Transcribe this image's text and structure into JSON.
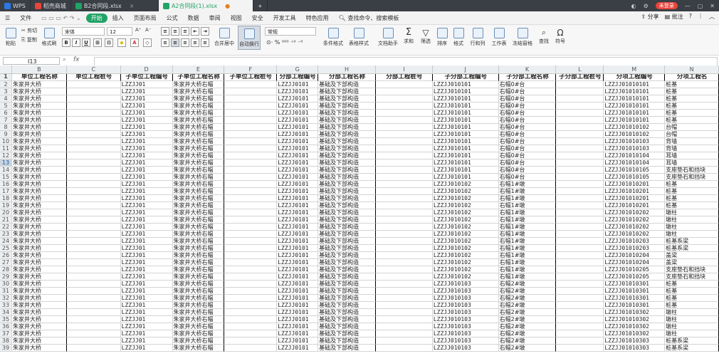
{
  "titlebar": {
    "tabs": [
      {
        "label": "WPS",
        "color": "#2b78e4"
      },
      {
        "label": "稻壳商城",
        "color": "#e8453c"
      },
      {
        "label": "B2合同段.xlsx",
        "color": "#21a366"
      },
      {
        "label": "A2合同段(1).xlsx",
        "color": "#21a366"
      }
    ],
    "badge": "未登录"
  },
  "menubar": {
    "file": "文件",
    "items": [
      "开始",
      "插入",
      "页面布局",
      "公式",
      "数据",
      "审阅",
      "视图",
      "安全",
      "开发工具",
      "特色应用"
    ],
    "search": "查找命令、搜索模板",
    "share": "分享",
    "comment": "批注"
  },
  "ribbon": {
    "paste": "粘贴",
    "cut": "剪切",
    "copy": "复制",
    "format_painter": "格式刷",
    "font_name": "宋体",
    "font_size": "12",
    "merge_center": "合并居中",
    "wrap_text": "自动换行",
    "number_format": "常规",
    "conditional_format": "条件格式",
    "table_style": "表格样式",
    "doc_helper": "文档助手",
    "sum": "求和",
    "filter": "筛选",
    "sort": "排序",
    "format": "格式",
    "rows_cols": "行和列",
    "worksheet": "工作表",
    "freeze": "冻结窗格",
    "find": "查找",
    "symbol": "符号"
  },
  "formula_bar": {
    "name_box": "I13",
    "fx": "fx"
  },
  "columns": [
    {
      "key": "B",
      "w": 77
    },
    {
      "key": "C",
      "w": 76
    },
    {
      "key": "D",
      "w": 73
    },
    {
      "key": "E",
      "w": 73
    },
    {
      "key": "F",
      "w": 74
    },
    {
      "key": "G",
      "w": 58
    },
    {
      "key": "H",
      "w": 81
    },
    {
      "key": "I",
      "w": 80
    },
    {
      "key": "J",
      "w": 93
    },
    {
      "key": "K",
      "w": 81
    },
    {
      "key": "L",
      "w": 67
    },
    {
      "key": "M",
      "w": 86
    },
    {
      "key": "N",
      "w": 76
    }
  ],
  "header": [
    "单位工程名称",
    "单位工程桩号",
    "子单位工程编号",
    "子单位工程名称",
    "子单位工程桩号",
    "分部工程编号",
    "分部工程名称",
    "分部工程桩号",
    "子分部工程编号",
    "子分部工程名称",
    "子分部工程桩号",
    "分项工程编号",
    "分项工程名"
  ],
  "selected_row": 13,
  "rows": [
    {
      "n": 2,
      "D": "LZZJJ01",
      "G": "LZZJJ0101",
      "J": "LZZJJ010101",
      "K": "右幅0#台",
      "M": "LZZJJ01010101",
      "N": "桩基"
    },
    {
      "n": 3,
      "D": "LZZJJ01",
      "G": "LZZJJ0101",
      "J": "LZZJJ010101",
      "K": "右幅0#台",
      "M": "LZZJJ01010101",
      "N": "桩基"
    },
    {
      "n": 4,
      "D": "LZZJJ01",
      "G": "LZZJJ0101",
      "J": "LZZJJ010101",
      "K": "右幅0#台",
      "M": "LZZJJ01010101",
      "N": "桩基"
    },
    {
      "n": 5,
      "D": "LZZJJ01",
      "G": "LZZJJ0101",
      "J": "LZZJJ010101",
      "K": "右幅0#台",
      "M": "LZZJJ01010101",
      "N": "桩基"
    },
    {
      "n": 6,
      "D": "LZZJJ01",
      "G": "LZZJJ0101",
      "J": "LZZJJ010101",
      "K": "右幅0#台",
      "M": "LZZJJ01010101",
      "N": "桩基"
    },
    {
      "n": 7,
      "D": "LZZJJ01",
      "G": "LZZJJ0101",
      "J": "LZZJJ010101",
      "K": "右幅0#台",
      "M": "LZZJJ01010101",
      "N": "桩基"
    },
    {
      "n": 8,
      "D": "LZZJJ01",
      "G": "LZZJJ0101",
      "J": "LZZJJ010101",
      "K": "右幅0#台",
      "M": "LZZJJ01010102",
      "N": "台帽"
    },
    {
      "n": 9,
      "D": "LZZJJ01",
      "G": "LZZJJ0101",
      "J": "LZZJJ010101",
      "K": "右幅0#台",
      "M": "LZZJJ01010102",
      "N": "台帽"
    },
    {
      "n": 10,
      "D": "LZZJJ01",
      "G": "LZZJJ0101",
      "J": "LZZJJ010101",
      "K": "右幅0#台",
      "M": "LZZJJ01010103",
      "N": "背墙"
    },
    {
      "n": 11,
      "D": "LZZJJ01",
      "G": "LZZJJ0101",
      "J": "LZZJJ010101",
      "K": "右幅0#台",
      "M": "LZZJJ01010103",
      "N": "背墙"
    },
    {
      "n": 12,
      "D": "LZZJJ01",
      "G": "LZZJJ0101",
      "J": "LZZJJ010101",
      "K": "右幅0#台",
      "M": "LZZJJ01010104",
      "N": "耳墙"
    },
    {
      "n": 13,
      "D": "LZZJJ01",
      "G": "LZZJJ0101",
      "J": "LZZJJ010101",
      "K": "右幅0#台",
      "M": "LZZJJ01010104",
      "N": "耳墙"
    },
    {
      "n": 14,
      "D": "LZZJJ01",
      "G": "LZZJJ0101",
      "J": "LZZJJ010101",
      "K": "右幅0#台",
      "M": "LZZJJ01010105",
      "N": "支座垫石和挡块"
    },
    {
      "n": 15,
      "D": "LZZJJ01",
      "G": "LZZJJ0101",
      "J": "LZZJJ010101",
      "K": "右幅0#台",
      "M": "LZZJJ01010105",
      "N": "支座垫石和挡块"
    },
    {
      "n": 16,
      "D": "LZZJJ01",
      "G": "LZZJJ0101",
      "J": "LZZJJ010102",
      "K": "右幅1#墩",
      "M": "LZZJJ01010201",
      "N": "桩基"
    },
    {
      "n": 17,
      "D": "LZZJJ01",
      "G": "LZZJJ0101",
      "J": "LZZJJ010102",
      "K": "右幅1#墩",
      "M": "LZZJJ01010201",
      "N": "桩基"
    },
    {
      "n": 18,
      "D": "LZZJJ01",
      "G": "LZZJJ0101",
      "J": "LZZJJ010102",
      "K": "右幅1#墩",
      "M": "LZZJJ01010201",
      "N": "桩基"
    },
    {
      "n": 19,
      "D": "LZZJJ01",
      "G": "LZZJJ0101",
      "J": "LZZJJ010102",
      "K": "右幅1#墩",
      "M": "LZZJJ01010201",
      "N": "桩基"
    },
    {
      "n": 20,
      "D": "LZZJJ01",
      "G": "LZZJJ0101",
      "J": "LZZJJ010102",
      "K": "右幅1#墩",
      "M": "LZZJJ01010202",
      "N": "墩柱"
    },
    {
      "n": 21,
      "D": "LZZJJ01",
      "G": "LZZJJ0101",
      "J": "LZZJJ010102",
      "K": "右幅1#墩",
      "M": "LZZJJ01010202",
      "N": "墩柱"
    },
    {
      "n": 22,
      "D": "LZZJJ01",
      "G": "LZZJJ0101",
      "J": "LZZJJ010102",
      "K": "右幅1#墩",
      "M": "LZZJJ01010202",
      "N": "墩柱"
    },
    {
      "n": 23,
      "D": "LZZJJ01",
      "G": "LZZJJ0101",
      "J": "LZZJJ010102",
      "K": "右幅1#墩",
      "M": "LZZJJ01010202",
      "N": "墩柱"
    },
    {
      "n": 24,
      "D": "LZZJJ01",
      "G": "LZZJJ0101",
      "J": "LZZJJ010102",
      "K": "右幅1#墩",
      "M": "LZZJJ01010203",
      "N": "桩基系梁"
    },
    {
      "n": 25,
      "D": "LZZJJ01",
      "G": "LZZJJ0101",
      "J": "LZZJJ010102",
      "K": "右幅1#墩",
      "M": "LZZJJ01010203",
      "N": "桩基系梁"
    },
    {
      "n": 26,
      "D": "LZZJJ01",
      "G": "LZZJJ0101",
      "J": "LZZJJ010102",
      "K": "右幅1#墩",
      "M": "LZZJJ01010204",
      "N": "盖梁"
    },
    {
      "n": 27,
      "D": "LZZJJ01",
      "G": "LZZJJ0101",
      "J": "LZZJJ010102",
      "K": "右幅1#墩",
      "M": "LZZJJ01010204",
      "N": "盖梁"
    },
    {
      "n": 28,
      "D": "LZZJJ01",
      "G": "LZZJJ0101",
      "J": "LZZJJ010102",
      "K": "右幅1#墩",
      "M": "LZZJJ01010205",
      "N": "支座垫石和挡块"
    },
    {
      "n": 29,
      "D": "LZZJJ01",
      "G": "LZZJJ0101",
      "J": "LZZJJ010102",
      "K": "右幅1#墩",
      "M": "LZZJJ01010205",
      "N": "支座垫石和挡块"
    },
    {
      "n": 30,
      "D": "LZZJJ01",
      "G": "LZZJJ0101",
      "J": "LZZJJ010103",
      "K": "右幅2#墩",
      "M": "LZZJJ01010301",
      "N": "桩基"
    },
    {
      "n": 31,
      "D": "LZZJJ01",
      "G": "LZZJJ0101",
      "J": "LZZJJ010103",
      "K": "右幅2#墩",
      "M": "LZZJJ01010301",
      "N": "桩基"
    },
    {
      "n": 32,
      "D": "LZZJJ01",
      "G": "LZZJJ0101",
      "J": "LZZJJ010103",
      "K": "右幅2#墩",
      "M": "LZZJJ01010301",
      "N": "桩基"
    },
    {
      "n": 33,
      "D": "LZZJJ01",
      "G": "LZZJJ0101",
      "J": "LZZJJ010103",
      "K": "右幅2#墩",
      "M": "LZZJJ01010301",
      "N": "桩基"
    },
    {
      "n": 34,
      "D": "LZZJJ01",
      "G": "LZZJJ0101",
      "J": "LZZJJ010103",
      "K": "右幅2#墩",
      "M": "LZZJJ01010302",
      "N": "墩柱"
    },
    {
      "n": 35,
      "D": "LZZJJ01",
      "G": "LZZJJ0101",
      "J": "LZZJJ010103",
      "K": "右幅2#墩",
      "M": "LZZJJ01010302",
      "N": "墩柱"
    },
    {
      "n": 36,
      "D": "LZZJJ01",
      "G": "LZZJJ0101",
      "J": "LZZJJ010103",
      "K": "右幅2#墩",
      "M": "LZZJJ01010302",
      "N": "墩柱"
    },
    {
      "n": 37,
      "D": "LZZJJ01",
      "G": "LZZJJ0101",
      "J": "LZZJJ010103",
      "K": "右幅2#墩",
      "M": "LZZJJ01010302",
      "N": "墩柱"
    },
    {
      "n": 38,
      "D": "LZZJJ01",
      "G": "LZZJJ0101",
      "J": "LZZJJ010103",
      "K": "右幅2#墩",
      "M": "LZZJJ01010303",
      "N": "桩基系梁"
    },
    {
      "n": 39,
      "D": "LZZJJ01",
      "G": "LZZJJ0101",
      "J": "LZZJJ010103",
      "K": "右幅2#墩",
      "M": "LZZJJ01010303",
      "N": "桩基系梁"
    }
  ],
  "repeat_text": {
    "B": "朱家井大桥",
    "E": "朱家井大桥右幅",
    "H": "基础及下部构造"
  }
}
